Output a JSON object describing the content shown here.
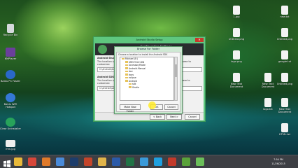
{
  "desktop_left": [
    {
      "label": "Recycle Bin",
      "color": "#d6d9dc"
    },
    {
      "label": "KMPlayer",
      "color": "#6b3f9c"
    },
    {
      "label": "Baidu PC Faster",
      "color": "#2a68c9"
    },
    {
      "label": "Baidu WiFi Hotspot",
      "color": "#3578d6"
    },
    {
      "label": "Clear Uninstaller",
      "color": "#27a35a"
    },
    {
      "label": "mm.jpg",
      "color": "#eeeeee"
    }
  ],
  "desktop_right": [
    {
      "label": "1.jpg",
      "color": "#f3f3f3"
    },
    {
      "label": "Untitled.png",
      "color": "#f3f3f3"
    },
    {
      "label": "logo.png",
      "color": "#f3f3f3"
    },
    {
      "label": "New Text Document",
      "color": "#f3f3f3"
    },
    {
      "label": "New Text Document",
      "color": "#f3f3f3"
    },
    {
      "label": "logo.txt",
      "color": "#f3f3f3"
    }
  ],
  "desktop_far_right": [
    {
      "label": "new.txt",
      "color": "#f3f3f3"
    },
    {
      "label": "Untitled.png",
      "color": "#f3f3f3"
    },
    {
      "label": "google.txt",
      "color": "#f3f3f3"
    },
    {
      "label": "Untitled.png",
      "color": "#f3f3f3"
    },
    {
      "label": "New Text Document",
      "color": "#f3f3f3"
    },
    {
      "label": "HTML.txt",
      "color": "#f3f3f3"
    }
  ],
  "setup_window": {
    "title": "Android Studio Setup",
    "close_label": "✕",
    "header_text": "Configuration Settings",
    "sections": [
      {
        "title": "Android Studio Installation Location",
        "desc": "The location specified must have at least 500MB of free space. Click Browse to customize:",
        "path": "C:\\Android\\Android Studio"
      },
      {
        "title": "Android SDK Installation Location",
        "desc": "The location specified must have at least 3.2GB of free space. Click Browse to customize:",
        "path": "C:\\android\\sdk"
      }
    ],
    "back_label": "< Back",
    "next_label": "Next >",
    "cancel_label": "Cancel"
  },
  "browse_dialog": {
    "title": "Browse For Folder",
    "instruction": "Choose a location to install the Android SDK",
    "tree": [
      {
        "label": "Michael (E:)",
        "indent": 0
      },
      {
        "label": "$RECYCLE.BIN",
        "indent": 1
      },
      {
        "label": "accessoryMode",
        "indent": 1
      },
      {
        "label": "Android.Manual",
        "indent": 1
      },
      {
        "label": "dev",
        "indent": 1
      },
      {
        "label": "docs",
        "indent": 1
      },
      {
        "label": "eclipse",
        "indent": 1
      },
      {
        "label": "Android",
        "indent": 1
      },
      {
        "label": "sdk",
        "indent": 2
      },
      {
        "label": "Studio",
        "indent": 2
      }
    ],
    "new_folder_label": "Make New Folder",
    "ok_label": "OK",
    "cancel_label": "Cancel"
  },
  "taskbar": {
    "apps": [
      {
        "name": "explorer-icon",
        "color": "#e8b93a"
      },
      {
        "name": "chrome-icon",
        "color": "#d7473a"
      },
      {
        "name": "firefox-icon",
        "color": "#e07a2a"
      },
      {
        "name": "media-icon",
        "color": "#4a8bd8"
      },
      {
        "name": "photoshop-icon",
        "color": "#1d3d6b"
      },
      {
        "name": "powerpoint-icon",
        "color": "#c4452a"
      },
      {
        "name": "folder-icon",
        "color": "#e0b44a"
      },
      {
        "name": "word-icon",
        "color": "#2b5aa8"
      },
      {
        "name": "excel-icon",
        "color": "#217346"
      },
      {
        "name": "browser-icon",
        "color": "#3a9ad9"
      },
      {
        "name": "skype-icon",
        "color": "#1fa0e0"
      },
      {
        "name": "java-icon",
        "color": "#c23a2a"
      },
      {
        "name": "utorrent-icon",
        "color": "#5aa23a"
      },
      {
        "name": "android-studio-icon",
        "color": "#6bbf5a"
      }
    ],
    "time": "7:54 PM",
    "date": "11/26/2015"
  }
}
